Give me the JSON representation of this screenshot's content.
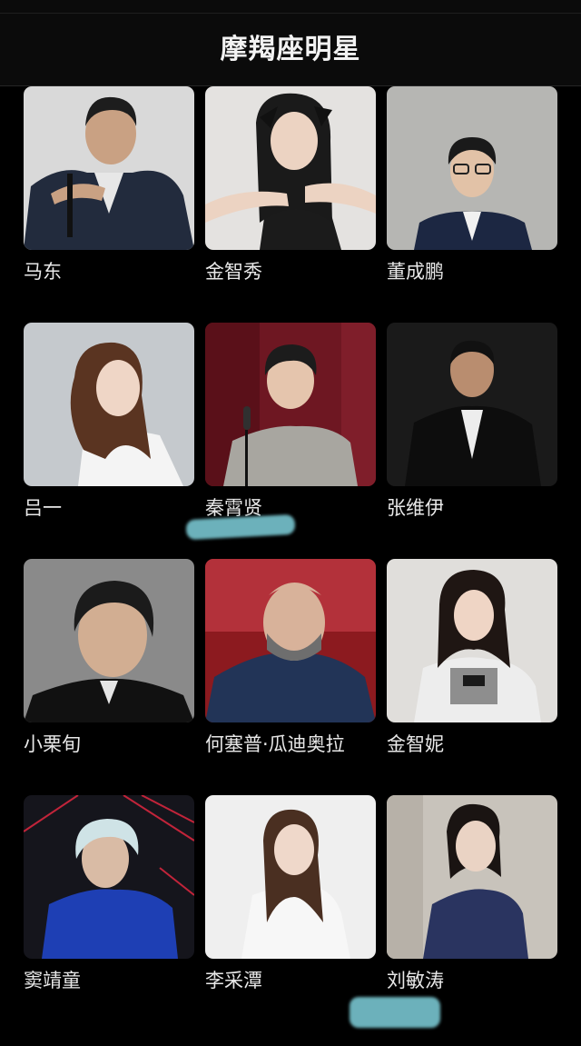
{
  "header": {
    "title": "摩羯座明星"
  },
  "celebrities": [
    {
      "name": "马东"
    },
    {
      "name": "金智秀"
    },
    {
      "name": "董成鹏"
    },
    {
      "name": "吕一"
    },
    {
      "name": "秦霄贤"
    },
    {
      "name": "张维伊"
    },
    {
      "name": "小栗旬"
    },
    {
      "name": "何塞普·瓜迪奥拉"
    },
    {
      "name": "金智妮"
    },
    {
      "name": "窦靖童"
    },
    {
      "name": "李采潭"
    },
    {
      "name": "刘敏涛"
    }
  ]
}
